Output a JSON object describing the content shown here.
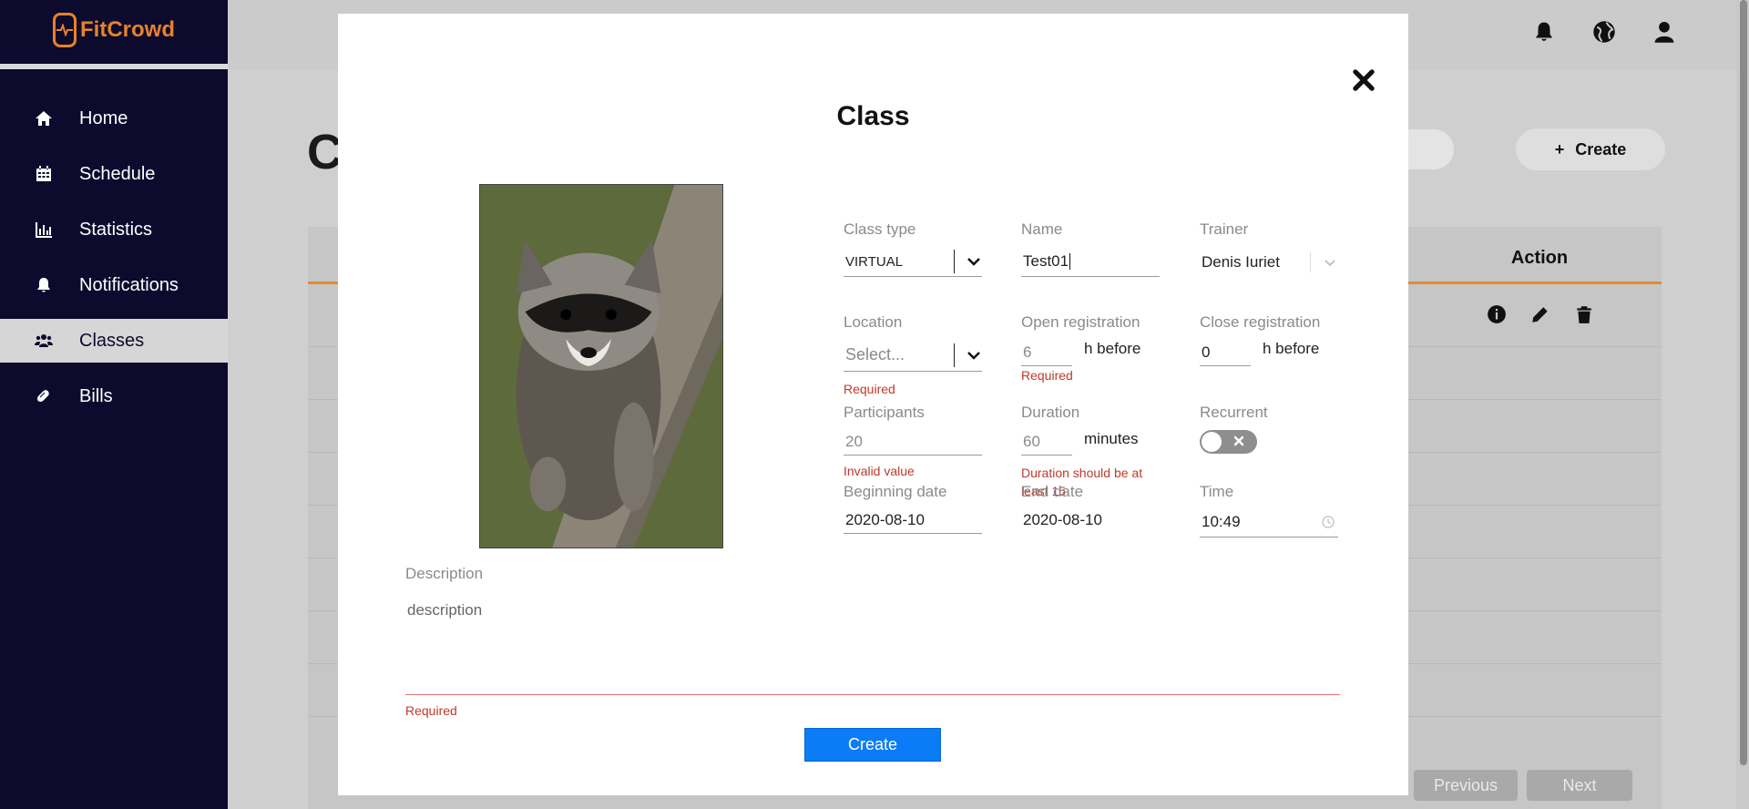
{
  "app": {
    "name": "FitCrowd"
  },
  "sidebar": {
    "items": [
      {
        "label": "Home",
        "icon": "home-icon"
      },
      {
        "label": "Schedule",
        "icon": "calendar-icon"
      },
      {
        "label": "Statistics",
        "icon": "bar-chart-icon"
      },
      {
        "label": "Notifications",
        "icon": "bell-icon"
      },
      {
        "label": "Classes",
        "icon": "users-icon",
        "active": true
      },
      {
        "label": "Bills",
        "icon": "pill-icon"
      }
    ]
  },
  "background": {
    "page_title_partial": "C",
    "create_label": "Create",
    "table_action_header": "Action",
    "pager_previous": "Previous",
    "pager_next": "Next"
  },
  "modal": {
    "title": "Class",
    "close_icon": "close-icon",
    "fields": {
      "class_type": {
        "label": "Class type",
        "value": "VIRTUAL"
      },
      "name": {
        "label": "Name",
        "value": "Test01"
      },
      "trainer": {
        "label": "Trainer",
        "value": "Denis Iuriet"
      },
      "location": {
        "label": "Location",
        "placeholder": "Select...",
        "error": "Required"
      },
      "open_registration": {
        "label": "Open registration",
        "value": "6",
        "suffix": "h before",
        "error": "Required"
      },
      "close_registration": {
        "label": "Close registration",
        "value": "0",
        "suffix": "h before"
      },
      "participants": {
        "label": "Participants",
        "value": "20",
        "error": "Invalid value"
      },
      "duration": {
        "label": "Duration",
        "value": "60",
        "suffix": "minutes",
        "error": "Duration should be at least 15"
      },
      "recurrent": {
        "label": "Recurrent",
        "enabled": false
      },
      "beginning_date": {
        "label": "Beginning date",
        "value": "2020-08-10"
      },
      "end_date": {
        "label": "End date",
        "value": "2020-08-10"
      },
      "time": {
        "label": "Time",
        "value": "10:49"
      },
      "description": {
        "label": "Description",
        "value": "description",
        "error": "Required"
      }
    },
    "create_label": "Create"
  },
  "colors": {
    "sidebar_bg": "#0c0b2e",
    "brand_orange": "#e8812b",
    "primary_button": "#0b7cf5",
    "error": "#c0392b"
  }
}
